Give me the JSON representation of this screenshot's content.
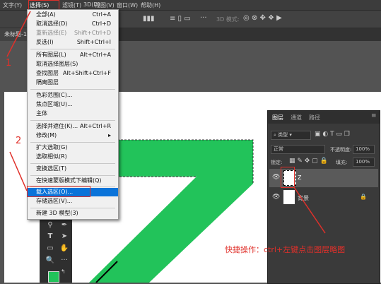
{
  "menubar": {
    "items": [
      "文字(Y)",
      "选择(S)",
      "滤镜(T)",
      "3D(D)",
      "视图(V)",
      "窗口(W)",
      "帮助(H)"
    ]
  },
  "optionsbar": {
    "mode_3d": "3D 模式:"
  },
  "document_tab": {
    "title": "未标题-1"
  },
  "select_menu": {
    "items": [
      {
        "label": "全部(A)",
        "shortcut": "Ctrl+A"
      },
      {
        "label": "取消选择(D)",
        "shortcut": "Ctrl+D"
      },
      {
        "label": "重新选择(E)",
        "shortcut": "Shift+Ctrl+D"
      },
      {
        "label": "反选(I)",
        "shortcut": "Shift+Ctrl+I"
      },
      {
        "label": "所有图层(L)",
        "shortcut": "Alt+Ctrl+A"
      },
      {
        "label": "取消选择图层(S)",
        "shortcut": ""
      },
      {
        "label": "查找图层",
        "shortcut": "Alt+Shift+Ctrl+F"
      },
      {
        "label": "隔离图层",
        "shortcut": ""
      },
      {
        "label": "色彩范围(C)...",
        "shortcut": ""
      },
      {
        "label": "焦点区域(U)...",
        "shortcut": ""
      },
      {
        "label": "主体",
        "shortcut": ""
      },
      {
        "label": "选择并遮住(K)...",
        "shortcut": "Alt+Ctrl+R"
      },
      {
        "label": "修改(M)",
        "shortcut": "▸"
      },
      {
        "label": "扩大选取(G)",
        "shortcut": ""
      },
      {
        "label": "选取相似(R)",
        "shortcut": ""
      },
      {
        "label": "变换选区(T)",
        "shortcut": ""
      },
      {
        "label": "在快速蒙版模式下编辑(Q)",
        "shortcut": ""
      },
      {
        "label": "载入选区(O)...",
        "shortcut": ""
      },
      {
        "label": "存储选区(V)...",
        "shortcut": ""
      },
      {
        "label": "新建 3D 模型(3)",
        "shortcut": ""
      }
    ]
  },
  "layers_panel": {
    "tabs": [
      "图层",
      "通道",
      "路径"
    ],
    "filter_kind": "类型",
    "blend_mode": "正常",
    "opacity_label": "不透明度:",
    "opacity_value": "100%",
    "lock_label": "锁定:",
    "fill_label": "填充:",
    "fill_value": "100%",
    "layers": [
      {
        "name": "Z"
      },
      {
        "name": "背景"
      }
    ]
  },
  "annotations": {
    "step1": "1",
    "step2": "2",
    "tip": "快捷操作：ctrl+左键点击图层略图"
  },
  "colors": {
    "accent_red": "#e0302a",
    "shape_green": "#22c35a",
    "menu_highlight": "#0a73d9"
  }
}
